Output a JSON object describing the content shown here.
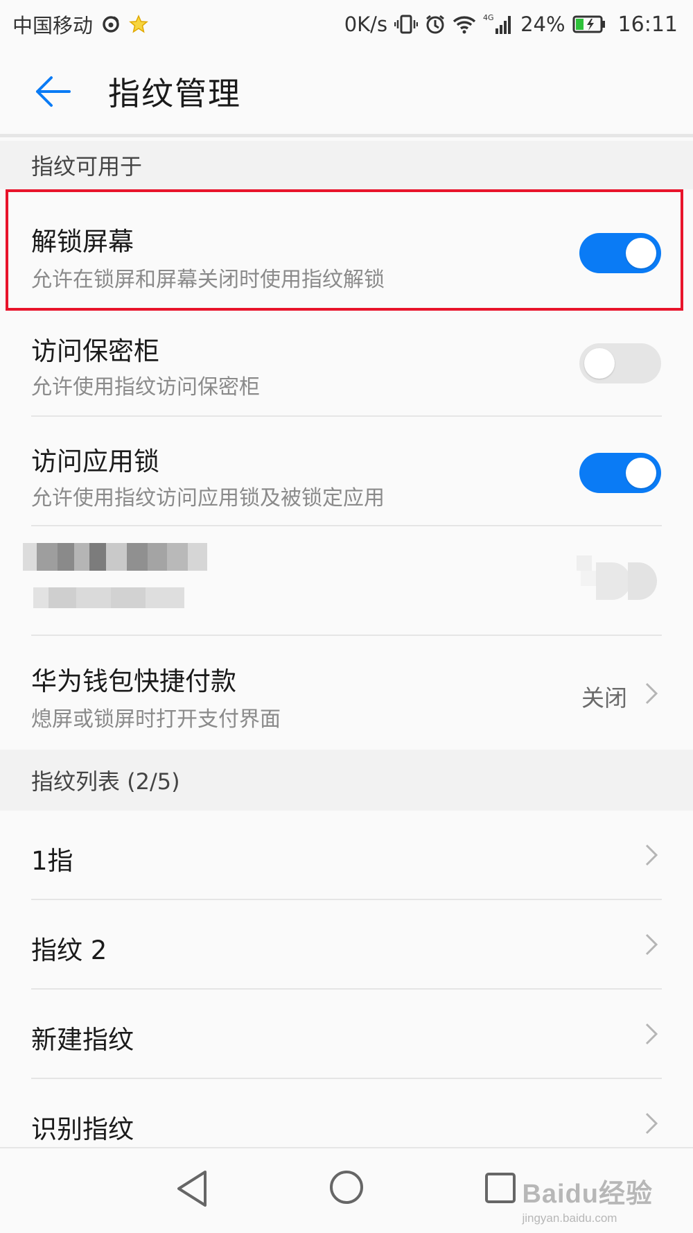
{
  "status_bar": {
    "carrier": "中国移动",
    "net_speed": "0K/s",
    "network_type": "4G",
    "battery": "24%",
    "time": "16:11"
  },
  "app_bar": {
    "title": "指纹管理"
  },
  "section_usage": {
    "title": "指纹可用于",
    "rows": [
      {
        "title": "解锁屏幕",
        "subtitle": "允许在锁屏和屏幕关闭时使用指纹解锁",
        "toggle": true
      },
      {
        "title": "访问保密柜",
        "subtitle": "允许使用指纹访问保密柜",
        "toggle": false
      },
      {
        "title": "访问应用锁",
        "subtitle": "允许使用指纹访问应用锁及被锁定应用",
        "toggle": true
      },
      {
        "title": "",
        "subtitle": "",
        "toggle": false
      },
      {
        "title": "华为钱包快捷付款",
        "subtitle": "熄屏或锁屏时打开支付界面",
        "value": "关闭"
      }
    ]
  },
  "section_list": {
    "title": "指纹列表 (2/5)",
    "items": [
      {
        "label": "1指"
      },
      {
        "label": "指纹 2"
      },
      {
        "label": "新建指纹"
      },
      {
        "label": "识别指纹"
      }
    ]
  },
  "watermark": {
    "logo": "Baidu经验",
    "url": "jingyan.baidu.com"
  },
  "colors": {
    "accent": "#0a7bf5",
    "highlight": "#e8142b",
    "toggle_off": "#e5e5e5"
  }
}
